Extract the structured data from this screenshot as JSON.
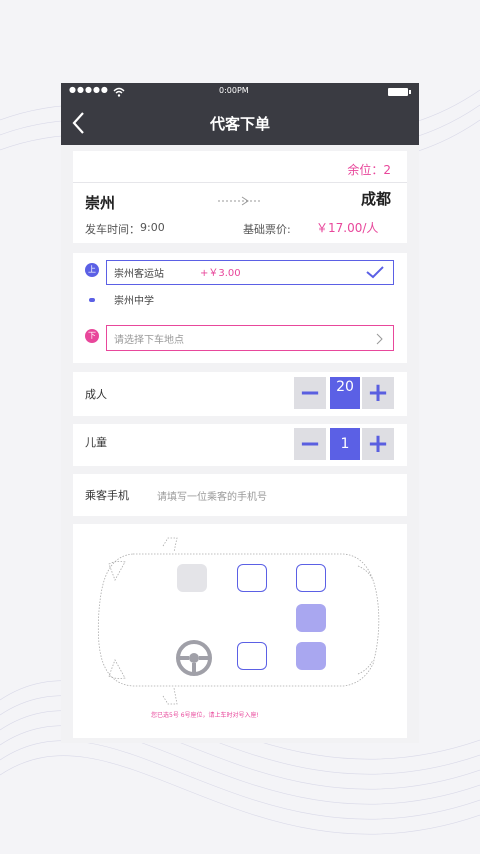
{
  "status": {
    "time": "0:00PM"
  },
  "nav": {
    "title": "代客下单"
  },
  "route": {
    "seats_left": "余位：2",
    "origin": "崇州",
    "destination": "成都",
    "depart_label": "发车时间：",
    "depart_time": "9:00",
    "fare_label": "基础票价:",
    "fare": "￥17.00/人"
  },
  "stops": {
    "boarding_badge": "上",
    "boarding_station": "崇州客运站",
    "boarding_surcharge": "+￥3.00",
    "middle_station": "崇州中学",
    "alighting_badge": "下",
    "alighting_placeholder": "请选择下车地点"
  },
  "passengers": {
    "adult_label": "成人",
    "adult_count": "20",
    "child_label": "儿童",
    "child_count": "1",
    "minus": "−",
    "plus": "+"
  },
  "phone": {
    "label": "乘客手机",
    "placeholder": "请填写一位乘客的手机号"
  },
  "seatmap": {
    "note": "您已选5号 6号座位，请上车时对号入座!"
  },
  "colors": {
    "accent": "#5b60e5",
    "pink": "#e8479b",
    "header": "#3a3b42"
  }
}
